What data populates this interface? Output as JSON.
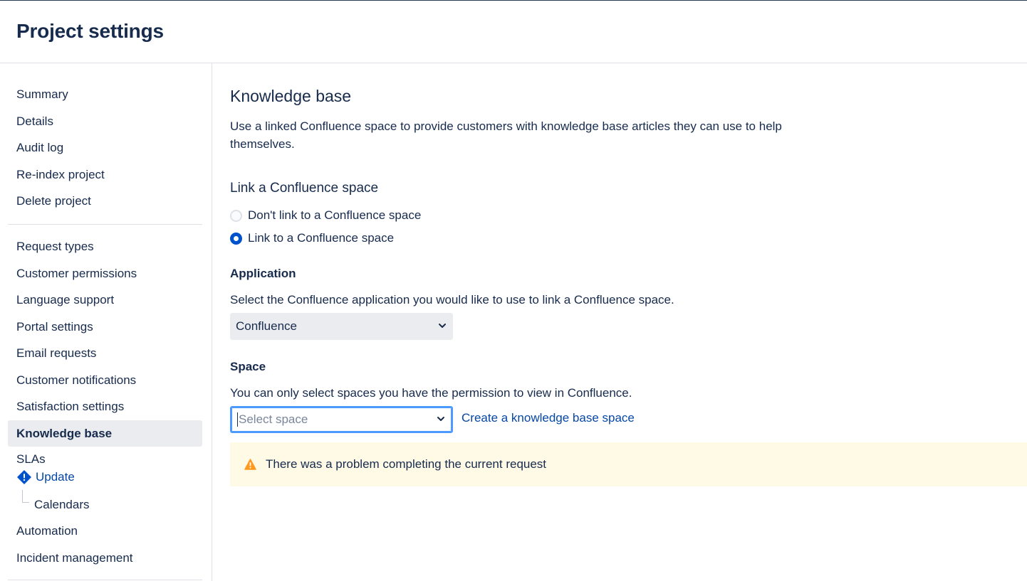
{
  "page": {
    "title": "Project settings"
  },
  "sidebar": {
    "group1": [
      "Summary",
      "Details",
      "Audit log",
      "Re-index project",
      "Delete project"
    ],
    "group2": [
      "Request types",
      "Customer permissions",
      "Language support",
      "Portal settings",
      "Email requests",
      "Customer notifications",
      "Satisfaction settings",
      "Knowledge base",
      "SLAs"
    ],
    "active": "Knowledge base",
    "sla_update_label": "Update",
    "sla_child": "Calendars",
    "group3": [
      "Automation",
      "Incident management"
    ]
  },
  "main": {
    "heading": "Knowledge base",
    "description": "Use a linked Confluence space to provide customers with knowledge base articles they can use to help themselves.",
    "link_section_title": "Link a Confluence space",
    "radio_options": [
      {
        "label": "Don't link to a Confluence space",
        "checked": false
      },
      {
        "label": "Link to a Confluence space",
        "checked": true
      }
    ],
    "application_label": "Application",
    "application_help": "Select the Confluence application you would like to use to link a Confluence space.",
    "application_value": "Confluence",
    "space_label": "Space",
    "space_help": "You can only select spaces you have the permission to view in Confluence.",
    "space_placeholder": "Select space",
    "create_link": "Create a knowledge base space",
    "warning_text": "There was a problem completing the current request"
  },
  "colors": {
    "text": "#172b4d",
    "link": "#0747a6",
    "primary": "#0052cc",
    "warning_bg": "#fffae6",
    "warning_icon": "#ff991f",
    "focus_border": "#4c9aff"
  },
  "icons": {
    "warning": "warning-icon",
    "update": "alert-diamond-icon",
    "chevron": "chevron-down-icon"
  }
}
